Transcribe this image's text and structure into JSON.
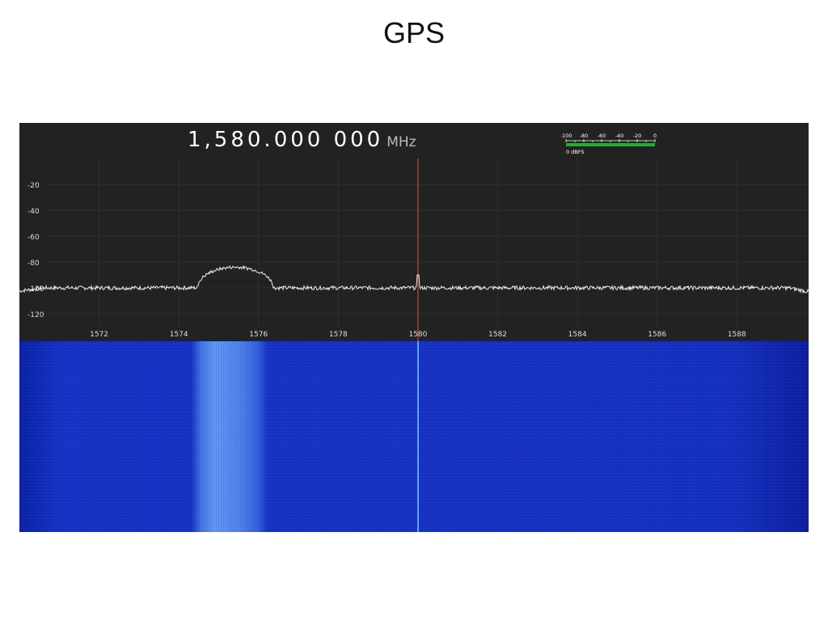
{
  "slide": {
    "title": "GPS"
  },
  "receiver": {
    "frequency_digits": "1,580.000 000",
    "frequency_unit": "MHz",
    "level_meter": {
      "scale_labels": [
        "-100",
        "-80",
        "-60",
        "-40",
        "-20",
        "0"
      ],
      "readout": "0 dBFS",
      "bar_color": "#22b02b"
    }
  },
  "colors": {
    "panel_background": "#222222",
    "trace": "#eeeeee",
    "center_marker": "#d9534f",
    "waterfall_base": "#1633c6",
    "waterfall_signal": "#6fa8ff"
  },
  "spectrum": {
    "x_ticks": [
      1572,
      1574,
      1576,
      1578,
      1580,
      1582,
      1584,
      1586,
      1588
    ],
    "y_ticks": [
      -20,
      -40,
      -60,
      -80,
      -100,
      -120
    ],
    "x_range_mhz": [
      1570,
      1589.8
    ],
    "y_range_db": [
      -130,
      0
    ],
    "center_frequency_mhz": 1580,
    "noise_floor_db": -100,
    "features": {
      "gps_l1_hump": {
        "center_mhz": 1575.42,
        "half_width_mhz": 0.95,
        "peak_db": -84
      },
      "dc_spike": {
        "freq_mhz": 1580,
        "peak_db": -90
      }
    }
  }
}
